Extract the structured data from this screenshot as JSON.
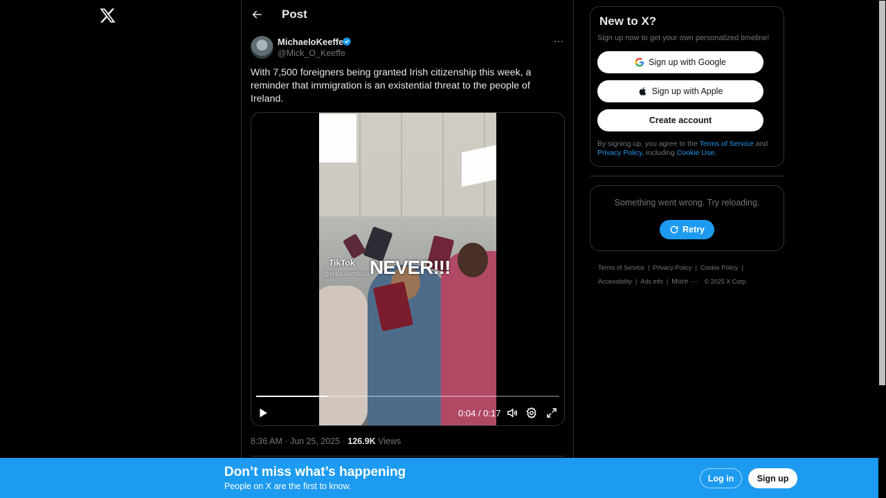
{
  "nav": {
    "logo_icon": "x-logo-icon"
  },
  "header": {
    "back_icon": "back-arrow-icon",
    "title": "Post"
  },
  "tweet": {
    "author_name": "MichaeloKeeffe",
    "author_handle": "@Mick_O_Keeffe",
    "verified_icon": "verified-badge-icon",
    "more_icon": "more-dots-icon",
    "text": "With 7,500 foreigners being granted Irish citizenship this week, a reminder that immigration is an existential threat to the people of Ireland.",
    "video": {
      "overlay_text": "NEVER!!!",
      "tiktok_label": "TikTok",
      "tiktok_handle": "@prequinchousxx",
      "progress": 0.235,
      "time": "0:04 / 0:17",
      "play_icon": "play-icon",
      "volume_icon": "volume-icon",
      "settings_icon": "gear-icon",
      "fullscreen_icon": "fullscreen-icon"
    },
    "timestamp": "8:36 AM · Jun 25, 2025 · ",
    "views_count": "126.9K",
    "views_label": " Views"
  },
  "signup_card": {
    "title": "New to X?",
    "subtitle": "Sign up now to get your own personalized timeline!",
    "google_label": "Sign up with Google",
    "apple_label": "Sign up with Apple",
    "create_label": "Create account",
    "terms_prefix": "By signing up, you agree to the ",
    "terms_link": "Terms of Service",
    "terms_and": " and ",
    "privacy_link": "Privacy Policy",
    "terms_including": ", including ",
    "cookie_link": "Cookie Use",
    "terms_end": "."
  },
  "error_card": {
    "message": "Something went wrong. Try reloading.",
    "retry_label": "Retry"
  },
  "footer": {
    "terms": "Terms of Service",
    "privacy": "Privacy Policy",
    "cookie": "Cookie Policy",
    "accessibility": "Accessibility",
    "ads": "Ads info",
    "more": "More ···",
    "copyright": "© 2025 X Corp."
  },
  "banner": {
    "title": "Don’t miss what’s happening",
    "subtitle": "People on X are the first to know.",
    "login_label": "Log in",
    "signup_label": "Sign up"
  },
  "colors": {
    "accent": "#1d9bf0",
    "background": "#000000",
    "border": "#2f3336",
    "muted_text": "#71767b"
  }
}
